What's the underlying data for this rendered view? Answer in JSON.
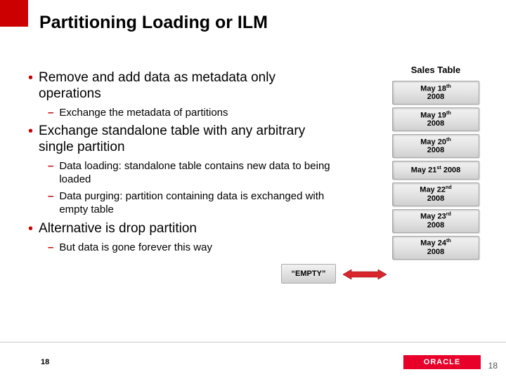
{
  "title": "Partitioning Loading or ILM",
  "bullets": {
    "b1": "Remove and add data as metadata only operations",
    "b1s1": "Exchange the metadata of partitions",
    "b2": "Exchange standalone table with any arbitrary single partition",
    "b2s1": "Data loading: standalone table contains new data to being loaded",
    "b2s2": "Data purging: partition containing data is exchanged with empty table",
    "b3": "Alternative is drop partition",
    "b3s1": "But data is gone forever this way"
  },
  "sales_table": {
    "title": "Sales Table",
    "p1a": "May 18",
    "p1b": "th",
    "p1c": "2008",
    "p2a": "May 19",
    "p2b": "th",
    "p2c": "2008",
    "p3a": "May 20",
    "p3b": "th",
    "p3c": "2008",
    "p4a": "May 21",
    "p4b": "st",
    "p4c": " 2008",
    "p5a": "May 22",
    "p5b": "nd",
    "p5c": "2008",
    "p6a": "May 23",
    "p6b": "rd",
    "p6c": "2008",
    "p7a": "May 24",
    "p7b": "th",
    "p7c": "2008"
  },
  "empty_label": "“EMPTY”",
  "page_number": "18",
  "logo_text": "ORACLE"
}
